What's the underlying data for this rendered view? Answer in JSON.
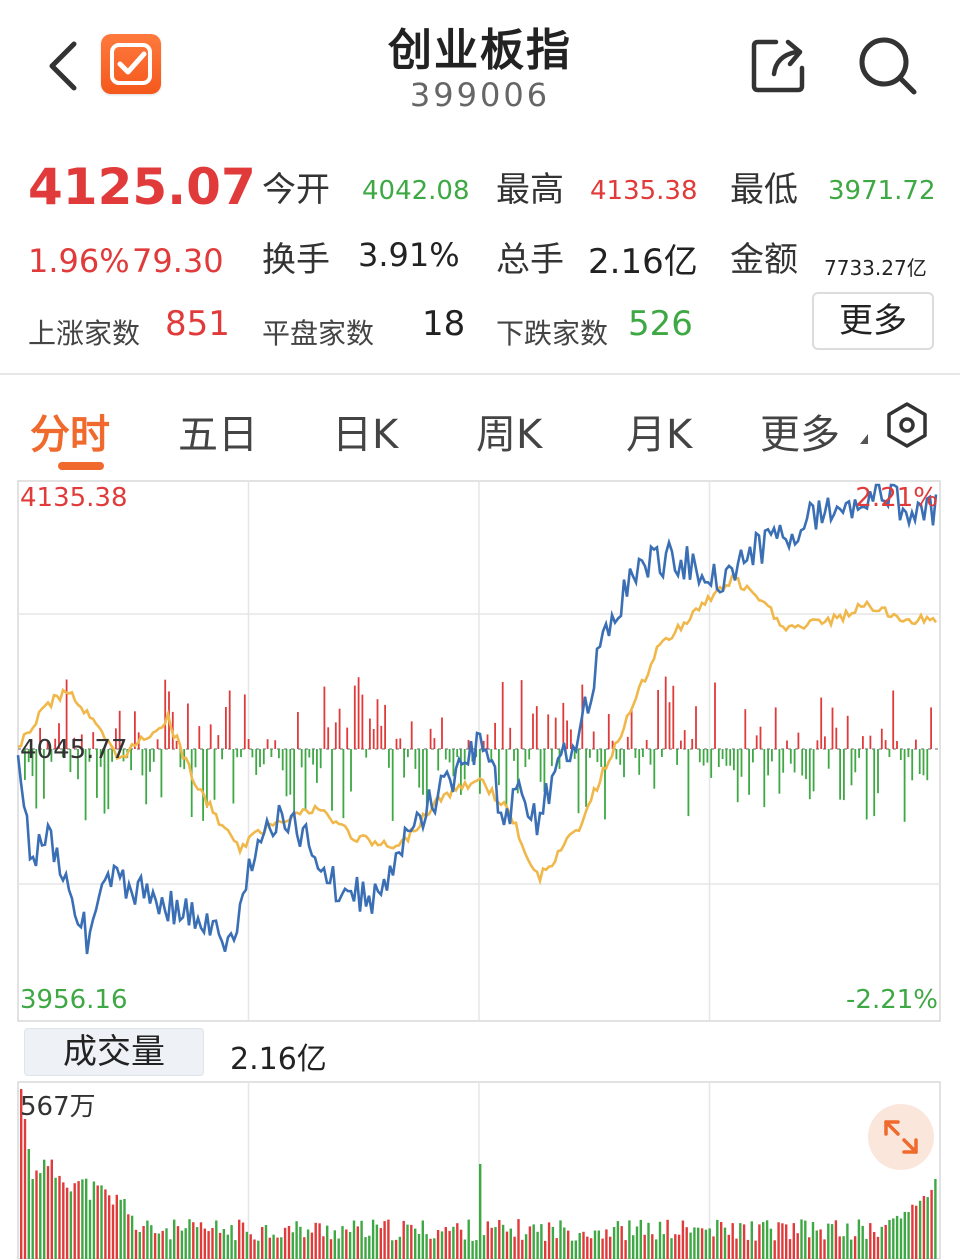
{
  "header": {
    "title": "创业板指",
    "code": "399006"
  },
  "quote": {
    "price": "4125.07",
    "change_pct": "1.96%",
    "change_abs": "79.30",
    "open_label": "今开",
    "open": "4042.08",
    "high_label": "最高",
    "high": "4135.38",
    "low_label": "最低",
    "low": "3971.72",
    "turnover_label": "换手",
    "turnover": "3.91%",
    "volume_label": "总手",
    "volume": "2.16亿",
    "amount_label": "金额",
    "amount": "7733.27亿",
    "up_label": "上涨家数",
    "up": "851",
    "flat_label": "平盘家数",
    "flat": "18",
    "down_label": "下跌家数",
    "down": "526",
    "more_label": "更多"
  },
  "tabs": [
    {
      "label": "分时",
      "active": true
    },
    {
      "label": "五日"
    },
    {
      "label": "日K"
    },
    {
      "label": "周K"
    },
    {
      "label": "月K"
    },
    {
      "label": "更多"
    }
  ],
  "chart_axis": {
    "max": "4135.38",
    "mid": "4045.77",
    "min": "3956.16",
    "max_pct": "2.21%",
    "min_pct": "-2.21%"
  },
  "volume": {
    "label": "成交量",
    "value": "2.16亿",
    "max": "567万"
  },
  "colors": {
    "up": "#e03a3a",
    "down": "#3ea844",
    "accent": "#ef6a2c",
    "price_line": "#3a6fb5",
    "avg_line": "#f0b84a"
  },
  "chart_data": {
    "type": "line",
    "x_sessions": 240,
    "ylim": [
      3956.16,
      4135.38
    ],
    "baseline": 4045.77,
    "series": [],
    "volume_ylim_label": "567万"
  }
}
